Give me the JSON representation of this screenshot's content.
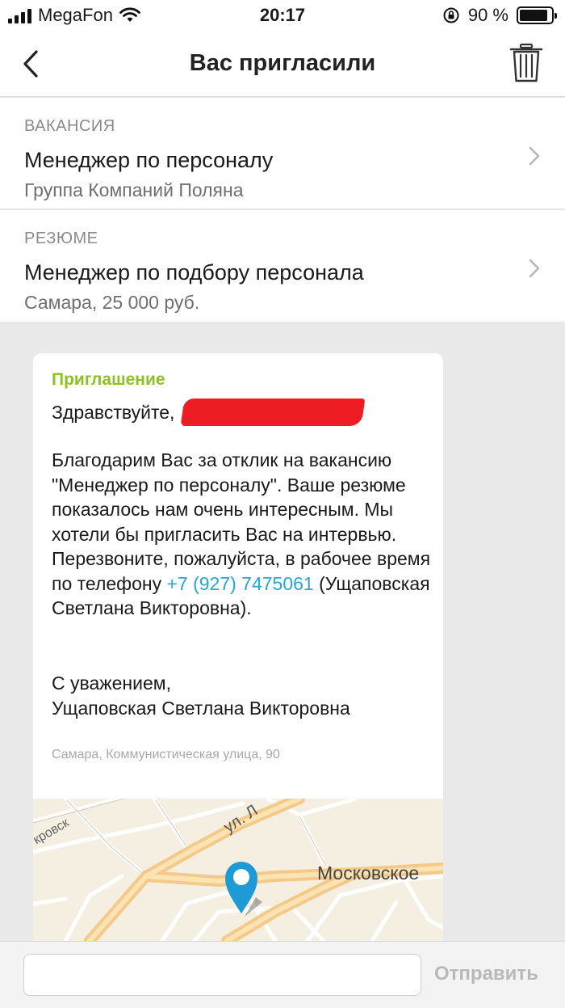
{
  "status_bar": {
    "carrier": "MegaFon",
    "time": "20:17",
    "battery": "90 %",
    "battery_level": 0.9
  },
  "nav": {
    "title": "Вас пригласили"
  },
  "vacancy": {
    "label": "ВАКАНСИЯ",
    "title": "Менеджер по персоналу",
    "company": "Группа Компаний Поляна"
  },
  "resume": {
    "label": "РЕЗЮМЕ",
    "title": "Менеджер по подбору персонала",
    "details": "Самара, 25 000 руб."
  },
  "message": {
    "title": "Приглашение",
    "greeting": "Здравствуйте,",
    "body_before_phone": "Благодарим Вас за отклик на вакансию \"Менеджер по персоналу\". Ваше резюме показалось нам очень интересным. Мы хотели бы пригласить Вас на интервью. Перезвоните, пожалуйста, в рабочее время по телефону ",
    "phone": "+7 (927) 7475061",
    "body_after_phone": " (Ущаповская Светлана Викторовна).",
    "sign_line1": "С уважением,",
    "sign_line2": "Ущаповская Светлана Викторовна",
    "address": "Самара, Коммунистическая улица, 90"
  },
  "map": {
    "label_street": "ул. Л",
    "label_pokrovsk": "кровск",
    "label_moskovskoe": "Московское",
    "pin_color": "#1e9ad6"
  },
  "input": {
    "value": "",
    "placeholder": "",
    "send_label": "Отправить"
  },
  "colors": {
    "accent_green": "#8dc21f",
    "link_blue": "#29a5d6",
    "redaction_red": "#ee1c23"
  }
}
